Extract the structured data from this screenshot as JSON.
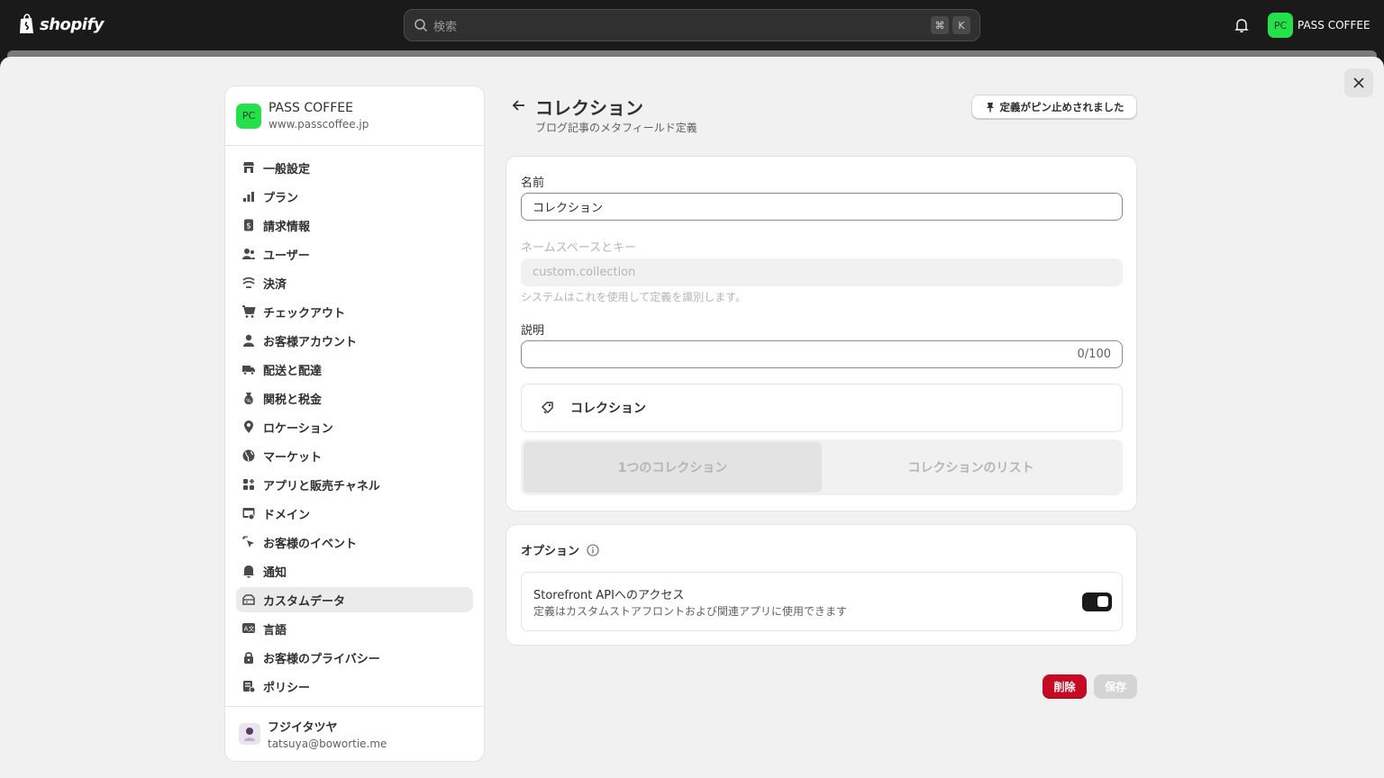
{
  "topbar": {
    "brand": "shopify",
    "search_placeholder": "検索",
    "shortcut_cmd": "⌘",
    "shortcut_key": "K",
    "store_initials": "PC",
    "store_name": "PASS COFFEE"
  },
  "sidebar": {
    "store_initials": "PC",
    "store_name": "PASS COFFEE",
    "store_url": "www.passcoffee.jp",
    "items": [
      {
        "label": "一般設定",
        "icon": "store-icon"
      },
      {
        "label": "プラン",
        "icon": "plan-icon"
      },
      {
        "label": "請求情報",
        "icon": "billing-icon"
      },
      {
        "label": "ユーザー",
        "icon": "users-icon"
      },
      {
        "label": "決済",
        "icon": "payments-icon"
      },
      {
        "label": "チェックアウト",
        "icon": "cart-icon"
      },
      {
        "label": "お客様アカウント",
        "icon": "person-icon"
      },
      {
        "label": "配送と配達",
        "icon": "truck-icon"
      },
      {
        "label": "関税と税金",
        "icon": "tax-icon"
      },
      {
        "label": "ロケーション",
        "icon": "location-icon"
      },
      {
        "label": "マーケット",
        "icon": "globe-icon"
      },
      {
        "label": "アプリと販売チャネル",
        "icon": "apps-icon"
      },
      {
        "label": "ドメイン",
        "icon": "domain-icon"
      },
      {
        "label": "お客様のイベント",
        "icon": "cursor-icon"
      },
      {
        "label": "通知",
        "icon": "bell-icon"
      },
      {
        "label": "カスタムデータ",
        "icon": "database-icon"
      },
      {
        "label": "言語",
        "icon": "language-icon"
      },
      {
        "label": "お客様のプライバシー",
        "icon": "lock-icon"
      },
      {
        "label": "ポリシー",
        "icon": "policy-icon"
      }
    ],
    "active_index": 15,
    "user_name": "フジイタツヤ",
    "user_email": "tatsuya@bowortie.me"
  },
  "page": {
    "title": "コレクション",
    "subtitle": "ブログ記事のメタフィールド定義",
    "pin_label": "定義がピン止めされました"
  },
  "form": {
    "name_label": "名前",
    "name_value": "コレクション",
    "namespace_label": "ネームスペースとキー",
    "namespace_value": "custom.collection",
    "namespace_help": "システムはこれを使用して定義を識別します。",
    "description_label": "説明",
    "description_value": "",
    "description_counter": "0/100",
    "type_label": "コレクション",
    "segment_options": [
      "1つのコレクション",
      "コレクションのリスト"
    ],
    "segment_selected": 0
  },
  "options": {
    "title": "オプション",
    "storefront_title": "Storefront APIへのアクセス",
    "storefront_desc": "定義はカスタムストアフロントおよび関連アプリに使用できます",
    "storefront_enabled": true
  },
  "actions": {
    "delete_label": "削除",
    "save_label": "保存"
  },
  "colors": {
    "accent_green": "#24e04a",
    "danger": "#c70a24",
    "topbar": "#1a1a1a"
  }
}
